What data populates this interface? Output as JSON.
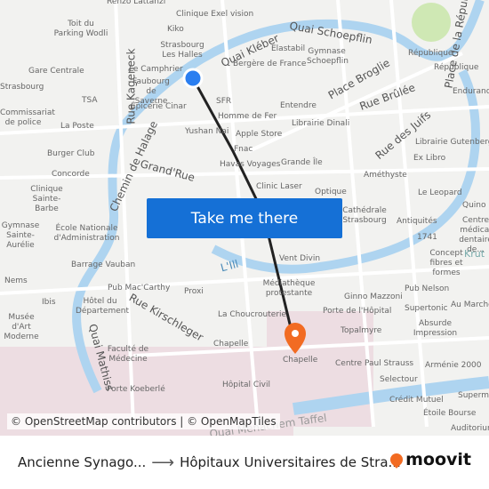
{
  "map": {
    "streets": [
      "Quai Kléber",
      "Quai Schoepflin",
      "Rue Kageneck",
      "Chemin de Halage",
      "Grand'Rue",
      "Place Broglie",
      "Rue Brûlée",
      "Rue des Juifs",
      "Rue Kirschleger",
      "Quai Mathiss",
      "Quai Menachem Taffel",
      "Place de la République",
      "L'Ill"
    ],
    "places": [
      "Renzo Lattanzi",
      "Clinique Exel vision",
      "Toit du Parking Wodli",
      "Kiko",
      "Strasbourg Les Halles",
      "Gare Centrale",
      "Le Camphrier",
      "Faubourg de Saverne",
      "Strasbourg",
      "TSA",
      "Épicerie Cinar",
      "Commissariat de police",
      "La Poste",
      "SFR",
      "Homme de Fer",
      "Yushan Nai",
      "Apple Store",
      "Fnac",
      "Burger Club",
      "Havas Voyages",
      "Grande Île",
      "Concorde",
      "Clinique Sainte-Barbe",
      "Clinic Laser",
      "Elastabil",
      "Gymnase Schoepflin",
      "Bergère de France",
      "République",
      "République",
      "Endurance",
      "Entendre",
      "Librairie Dinali",
      "Librairie Gutenberg",
      "Ex Libro",
      "Améthyste",
      "Optique",
      "Le Leopard",
      "Cathédrale Strasbourg",
      "Antiquités",
      "1741",
      "Concept fibres et formes",
      "École Nationale d'Administration",
      "Gymnase Sainte-Aurélie",
      "Barrage Vauban",
      "Vent Divin",
      "Médiathèque protestante",
      "Pub Mac'Carthy",
      "Proxi",
      "Ginno Mazzoni",
      "Pub Nelson",
      "Hôtel du Département",
      "Porte de l'Hôpital",
      "Supertonic",
      "La Choucrouterie",
      "Topalmyre",
      "Absurde Impression",
      "Chapelle",
      "Chapelle",
      "Faculté de Médecine",
      "Centre Paul Strauss",
      "Arménie 2000",
      "Porte Koeberlé",
      "Hôpital Civil",
      "Selectour",
      "Crédit Mutuel",
      "Étoile Bourse",
      "Auditorium",
      "Musée d'Art Moderne",
      "Ibis",
      "Nems",
      "Quino",
      "Centre médical dentaire de...",
      "Krut",
      "Au Marché",
      "Superm..."
    ]
  },
  "cta": {
    "label": "Take me there"
  },
  "attribution": "© OpenStreetMap contributors | © OpenMapTiles",
  "trip": {
    "origin": "Ancienne Synago...",
    "destination": "Hôpitaux Universitaires de Stra..."
  },
  "brand": {
    "name": "moovit",
    "color": "#f26b22"
  },
  "colors": {
    "accent": "#1570d6",
    "origin_marker": "#2a7ef0",
    "destination_marker": "#f26b22",
    "route": "#222222",
    "water": "#aed4f0"
  }
}
